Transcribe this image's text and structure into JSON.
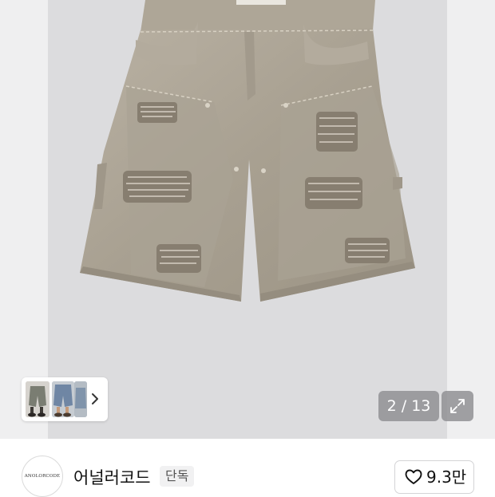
{
  "gallery": {
    "counter_text": "2 / 13",
    "image_icon": "product-photo-denim-shorts",
    "expand_icon": "expand-icon",
    "thumbnail_arrow_icon": "chevron-right-icon"
  },
  "brand": {
    "logo_text": "ANOLORCODE",
    "name": "어널러코드",
    "badge": "단독"
  },
  "like": {
    "icon": "heart-icon",
    "count": "9.3만"
  }
}
